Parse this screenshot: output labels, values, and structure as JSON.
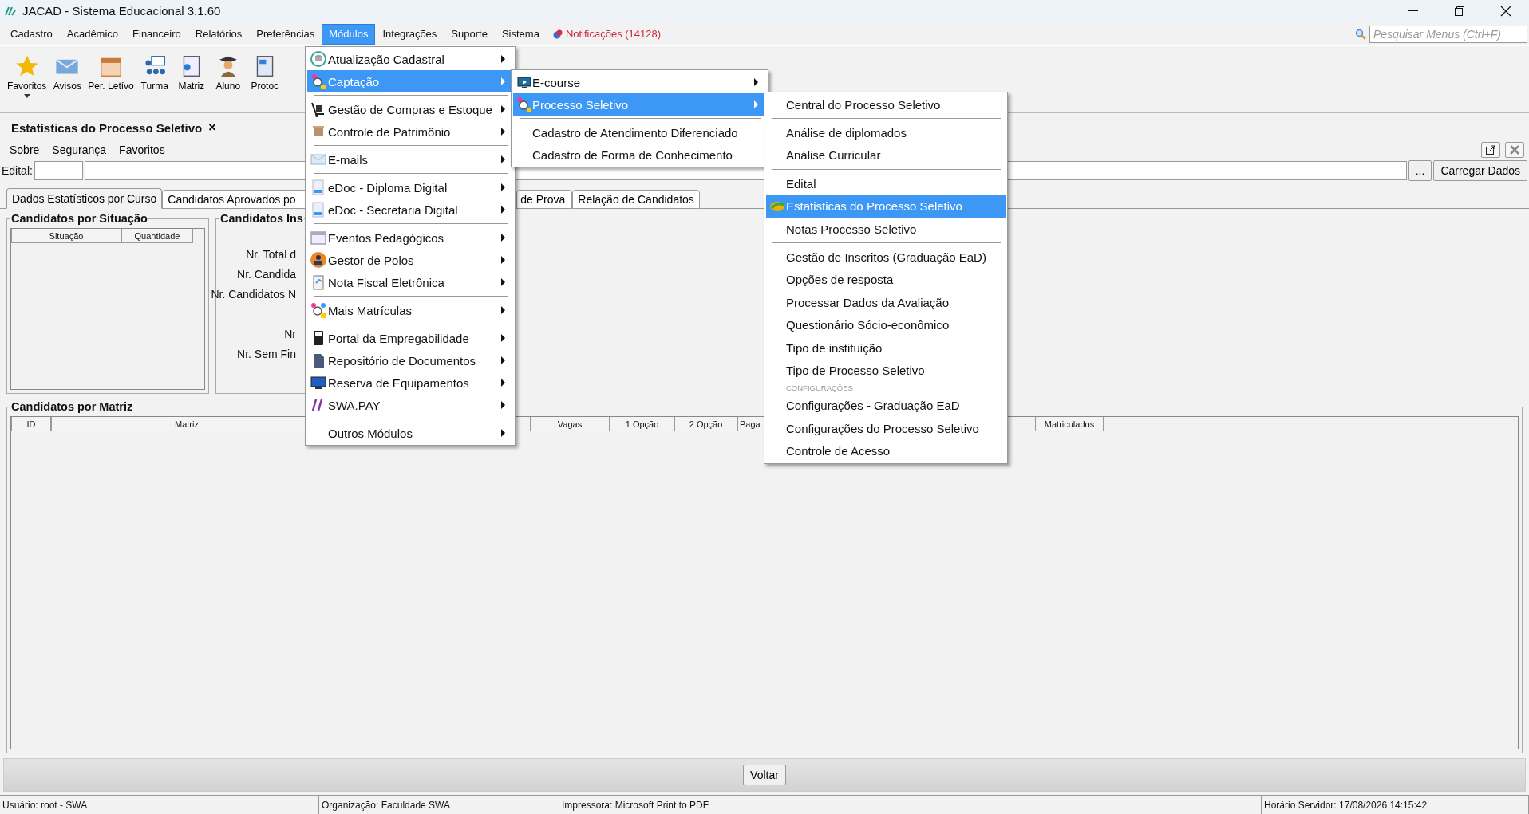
{
  "window": {
    "title": "JACAD - Sistema Educacional 3.1.60"
  },
  "menubar": {
    "items": [
      {
        "label": "Cadastro",
        "selected": false
      },
      {
        "label": "Acadêmico",
        "selected": false
      },
      {
        "label": "Financeiro",
        "selected": false
      },
      {
        "label": "Relatórios",
        "selected": false
      },
      {
        "label": "Preferências",
        "selected": false
      },
      {
        "label": "Módulos",
        "selected": true
      },
      {
        "label": "Integrações",
        "selected": false
      },
      {
        "label": "Suporte",
        "selected": false
      },
      {
        "label": "Sistema",
        "selected": false
      }
    ],
    "notifications": "Notificações (14128)",
    "search": {
      "placeholder": "Pesquisar Menus (Ctrl+F)"
    }
  },
  "toolbar": [
    {
      "label": "Favoritos"
    },
    {
      "label": "Avisos"
    },
    {
      "label": "Per. Letívo"
    },
    {
      "label": "Turma"
    },
    {
      "label": "Matriz"
    },
    {
      "label": "Aluno"
    },
    {
      "label": "Protoc"
    }
  ],
  "document_tab": {
    "title": "Estatísticas do Processo Seletivo",
    "close": "×"
  },
  "submenu_bar": [
    "Sobre",
    "Segurança",
    "Favoritos"
  ],
  "edital": {
    "label": "Edital:",
    "button_browse": "...",
    "button_load": "Carregar Dados"
  },
  "tabs": [
    {
      "label": "Dados Estatísticos por Curso",
      "selected": true
    },
    {
      "label": "Candidatos Aprovados po",
      "selected": false
    },
    {
      "label": "de Prova",
      "selected": false
    },
    {
      "label": "Relação de Candidatos",
      "selected": false
    }
  ],
  "panel_situacao": {
    "title": "Candidatos por Situação",
    "columns": [
      "Situação",
      "Quantidade"
    ]
  },
  "panel_inscritos": {
    "title": "Candidatos Ins",
    "labels": [
      "Nr. Total d",
      "Nr. Candida",
      "Nr. Candidatos N",
      "Nr",
      "Nr. Sem Fin"
    ]
  },
  "panel_matriz": {
    "title": "Candidatos por Matriz",
    "columns": [
      "ID",
      "Matriz",
      "Vagas",
      "1 Opção",
      "2 Opção",
      "Paga",
      "Matriculados"
    ]
  },
  "footer": {
    "button": "Voltar"
  },
  "status_bar": [
    "Usuário: root - SWA",
    "Organização: Faculdade SWA",
    "Impressora: Microsoft Print to PDF",
    "Horário Servidor: 17/08/2026 14:15:42"
  ],
  "menus": [
    {
      "items": [
        {
          "kind": "item",
          "label": "Atualização Cadastral",
          "selected": false,
          "submenu": true
        },
        {
          "kind": "item",
          "label": "Captação",
          "selected": true,
          "submenu": true
        },
        {
          "kind": "separator"
        },
        {
          "kind": "item",
          "label": "Gestão de Compras e Estoque",
          "selected": false,
          "submenu": true
        },
        {
          "kind": "item",
          "label": "Controle de Patrimônio",
          "selected": false,
          "submenu": true
        },
        {
          "kind": "separator"
        },
        {
          "kind": "item",
          "label": "E-mails",
          "selected": false,
          "submenu": true
        },
        {
          "kind": "separator"
        },
        {
          "kind": "item",
          "label": "eDoc - Diploma Digital",
          "selected": false,
          "submenu": true
        },
        {
          "kind": "item",
          "label": "eDoc - Secretaria Digital",
          "selected": false,
          "submenu": true
        },
        {
          "kind": "separator"
        },
        {
          "kind": "item",
          "label": "Eventos Pedagógicos",
          "selected": false,
          "submenu": true
        },
        {
          "kind": "item",
          "label": "Gestor de Polos",
          "selected": false,
          "submenu": true
        },
        {
          "kind": "item",
          "label": "Nota Fiscal Eletrônica",
          "selected": false,
          "submenu": true
        },
        {
          "kind": "separator"
        },
        {
          "kind": "item",
          "label": "Mais Matrículas",
          "selected": false,
          "submenu": true
        },
        {
          "kind": "separator"
        },
        {
          "kind": "item",
          "label": "Portal da Empregabilidade",
          "selected": false,
          "submenu": true
        },
        {
          "kind": "item",
          "label": "Repositório de Documentos",
          "selected": false,
          "submenu": true
        },
        {
          "kind": "item",
          "label": "Reserva de Equipamentos",
          "selected": false,
          "submenu": true
        },
        {
          "kind": "item",
          "label": "SWA.PAY",
          "selected": false,
          "submenu": true
        },
        {
          "kind": "separator"
        },
        {
          "kind": "item",
          "label": "Outros Módulos",
          "selected": false,
          "submenu": true
        }
      ]
    },
    {
      "items": [
        {
          "kind": "item",
          "label": "E-course",
          "selected": false,
          "submenu": true
        },
        {
          "kind": "item",
          "label": "Processo Seletivo",
          "selected": true,
          "submenu": true
        },
        {
          "kind": "separator"
        },
        {
          "kind": "item",
          "label": "Cadastro de Atendimento Diferenciado",
          "selected": false,
          "submenu": false
        },
        {
          "kind": "item",
          "label": "Cadastro de Forma de Conhecimento",
          "selected": false,
          "submenu": false
        }
      ]
    },
    {
      "items": [
        {
          "kind": "item",
          "label": "Central do Processo Seletivo",
          "selected": false
        },
        {
          "kind": "separator"
        },
        {
          "kind": "item",
          "label": "Análise de diplomados",
          "selected": false
        },
        {
          "kind": "item",
          "label": "Análise Curricular",
          "selected": false
        },
        {
          "kind": "separator"
        },
        {
          "kind": "item",
          "label": "Edital",
          "selected": false
        },
        {
          "kind": "item",
          "label": "Estatisticas do Processo Seletivo",
          "selected": true
        },
        {
          "kind": "item",
          "label": "Notas Processo Seletivo",
          "selected": false
        },
        {
          "kind": "separator"
        },
        {
          "kind": "item",
          "label": "Gestão de Inscritos (Graduação EaD)",
          "selected": false
        },
        {
          "kind": "item",
          "label": "Opções de resposta",
          "selected": false
        },
        {
          "kind": "item",
          "label": "Processar Dados da Avaliação",
          "selected": false
        },
        {
          "kind": "item",
          "label": "Questionário Sócio-econômico",
          "selected": false
        },
        {
          "kind": "item",
          "label": "Tipo de instituição",
          "selected": false
        },
        {
          "kind": "item",
          "label": "Tipo de Processo Seletivo",
          "selected": false
        },
        {
          "kind": "header",
          "label": "CONFIGURAÇÕES"
        },
        {
          "kind": "item",
          "label": "Configurações - Graduação EaD",
          "selected": false
        },
        {
          "kind": "item",
          "label": "Configurações do Processo Seletivo",
          "selected": false
        },
        {
          "kind": "item",
          "label": "Controle de Acesso",
          "selected": false
        }
      ]
    }
  ]
}
